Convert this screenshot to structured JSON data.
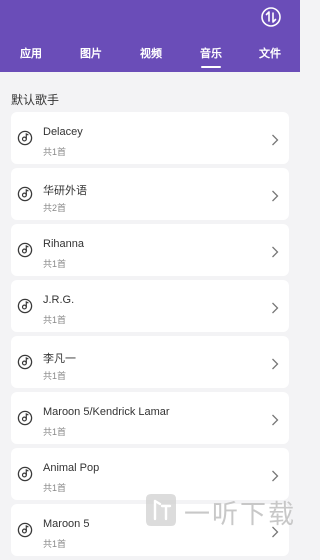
{
  "tabs": [
    {
      "label": "应用",
      "active": false
    },
    {
      "label": "图片",
      "active": false
    },
    {
      "label": "视频",
      "active": false
    },
    {
      "label": "音乐",
      "active": true
    },
    {
      "label": "文件",
      "active": false
    }
  ],
  "section_title": "默认歌手",
  "artists": [
    {
      "name": "Delacey",
      "count": "共1首"
    },
    {
      "name": "华研外语",
      "count": "共2首"
    },
    {
      "name": "Rihanna",
      "count": "共1首"
    },
    {
      "name": "J.R.G.",
      "count": "共1首"
    },
    {
      "name": "李凡一",
      "count": "共1首"
    },
    {
      "name": "Maroon 5/Kendrick Lamar",
      "count": "共1首"
    },
    {
      "name": "Animal Pop",
      "count": "共1首"
    },
    {
      "name": "Maroon 5",
      "count": "共1首"
    }
  ],
  "watermark_text": "一听下载",
  "colors": {
    "header": "#6a4db8",
    "background": "#f3f3f5"
  },
  "icons": {
    "top_right": "transfer-icon",
    "row_leading": "music-disc-icon",
    "row_trailing": "chevron-right-icon"
  }
}
